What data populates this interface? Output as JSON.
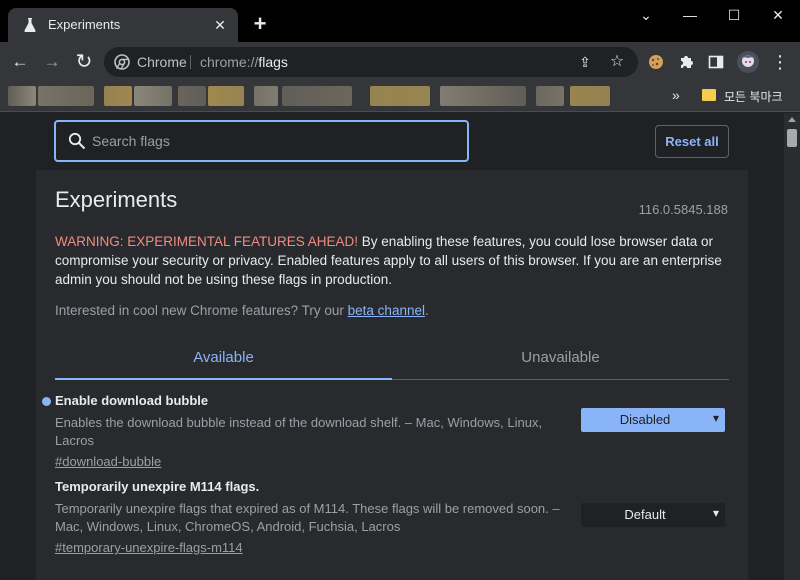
{
  "tab": {
    "title": "Experiments",
    "close": "✕",
    "new_tab": "+"
  },
  "window_controls": {
    "minimize": "—",
    "maximize": "☐",
    "close": "✕",
    "tab_search": "⌄"
  },
  "toolbar": {
    "back": "←",
    "forward": "→",
    "reload": "↻",
    "site_label": "Chrome",
    "url_prefix": "chrome://",
    "url_path": "flags",
    "share": "⇪",
    "star": "☆",
    "menu": "⋮"
  },
  "bookmarks": {
    "more": "»",
    "folder_label": "모든 북마크",
    "blurred_colors": [
      "#6e6a5f",
      "#8c8778",
      "#b49b58",
      "#a8a28e",
      "#7a7565",
      "#c4a356",
      "#8a8577",
      "#6f6b63",
      "#b69d5a",
      "#9a9484",
      "#7c7868",
      "#b89e56"
    ]
  },
  "page": {
    "search_placeholder": "Search flags",
    "reset_label": "Reset all",
    "title": "Experiments",
    "version": "116.0.5845.188",
    "warning_prefix": "WARNING: EXPERIMENTAL FEATURES AHEAD!",
    "warning_text": " By enabling these features, you could lose browser data or compromise your security or privacy. Enabled features apply to all users of this browser. If you are an enterprise admin you should not be using these flags in production.",
    "interest_text": "Interested in cool new Chrome features? Try our ",
    "interest_link": "beta channel",
    "interest_end": ".",
    "tabs": [
      {
        "label": "Available"
      },
      {
        "label": "Unavailable"
      }
    ],
    "experiments": [
      {
        "title": "Enable download bubble",
        "description": "Enables the download bubble instead of the download shelf. – Mac, Windows, Linux, Lacros",
        "link": "#download-bubble",
        "value": "Disabled",
        "modified": true
      },
      {
        "title": "Temporarily unexpire M114 flags.",
        "description": "Temporarily unexpire flags that expired as of M114. These flags will be removed soon. – Mac, Windows, Linux, ChromeOS, Android, Fuchsia, Lacros",
        "link": "#temporary-unexpire-flags-m114",
        "value": "Default",
        "modified": false
      }
    ]
  },
  "colors": {
    "accent": "#8ab4f8",
    "warning": "#f28b82",
    "background": "#202124",
    "card": "#292a2d"
  }
}
